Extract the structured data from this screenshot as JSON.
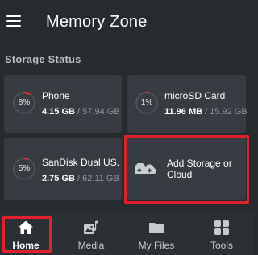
{
  "header": {
    "title": "Memory Zone",
    "menu_icon": "hamburger-menu-icon"
  },
  "storage_status": {
    "section_title": "Storage Status",
    "devices": [
      {
        "name": "Phone",
        "percent_label": "8%",
        "percent": 8,
        "used": "4.15 GB",
        "separator": "/",
        "total": "57.94 GB",
        "ring_color": "#e5312f"
      },
      {
        "name": "microSD Card",
        "percent_label": "1%",
        "percent": 1,
        "used": "11.96 MB",
        "separator": "/",
        "total": "15.92 GB",
        "ring_color": "#e5312f"
      },
      {
        "name": "SanDisk Dual US...",
        "percent_label": "5%",
        "percent": 5,
        "used": "2.75 GB",
        "separator": "/",
        "total": "62.11 GB",
        "ring_color": "#e5312f"
      }
    ],
    "add_card": {
      "label": "Add Storage or Cloud",
      "icon": "add-storage-cloud-icon"
    }
  },
  "bottom_nav": {
    "items": [
      {
        "label": "Home",
        "icon": "home-icon",
        "active": true
      },
      {
        "label": "Media",
        "icon": "media-icon",
        "active": false
      },
      {
        "label": "My Files",
        "icon": "folder-icon",
        "active": false
      },
      {
        "label": "Tools",
        "icon": "tools-grid-icon",
        "active": false
      }
    ]
  },
  "colors": {
    "background": "#262b30",
    "card": "#363c42",
    "accent_ring": "#e5312f",
    "highlight": "#e0202a"
  }
}
